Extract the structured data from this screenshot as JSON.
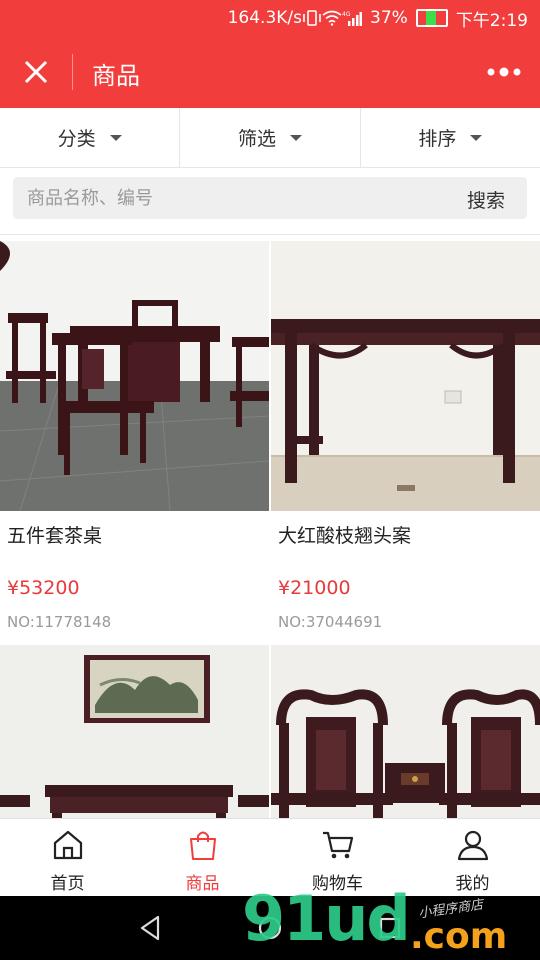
{
  "status_bar": {
    "speed": "164.3K/s",
    "network": "4G",
    "battery": "37%",
    "time": "下午2:19"
  },
  "header": {
    "title": "商品",
    "close_icon": "close-icon",
    "more_icon": "more-icon"
  },
  "filters": [
    {
      "label": "分类"
    },
    {
      "label": "筛选"
    },
    {
      "label": "排序"
    }
  ],
  "search": {
    "placeholder": "商品名称、编号",
    "button_label": "搜索"
  },
  "products": [
    {
      "name": "五件套茶桌",
      "price": "¥53200",
      "number": "NO:11778148",
      "image": "tea-table-set-photo"
    },
    {
      "name": "大红酸枝翘头案",
      "price": "¥21000",
      "number": "NO:37044691",
      "image": "console-table-photo"
    },
    {
      "name": "",
      "price": "",
      "number": "",
      "image": "desk-with-painting-photo"
    },
    {
      "name": "",
      "price": "",
      "number": "",
      "image": "carved-chairs-photo"
    }
  ],
  "tabs": [
    {
      "label": "首页",
      "icon": "home-icon",
      "active": false
    },
    {
      "label": "商品",
      "icon": "shopping-bag-icon",
      "active": true
    },
    {
      "label": "购物车",
      "icon": "cart-icon",
      "active": false
    },
    {
      "label": "我的",
      "icon": "user-icon",
      "active": false
    }
  ],
  "watermark": {
    "main": "91ud",
    "suffix": ".com",
    "sub": "小程序商店"
  },
  "colors": {
    "brand_red": "#f23d3d",
    "price_red": "#e8393c",
    "muted_gray": "#9a9a9a"
  }
}
